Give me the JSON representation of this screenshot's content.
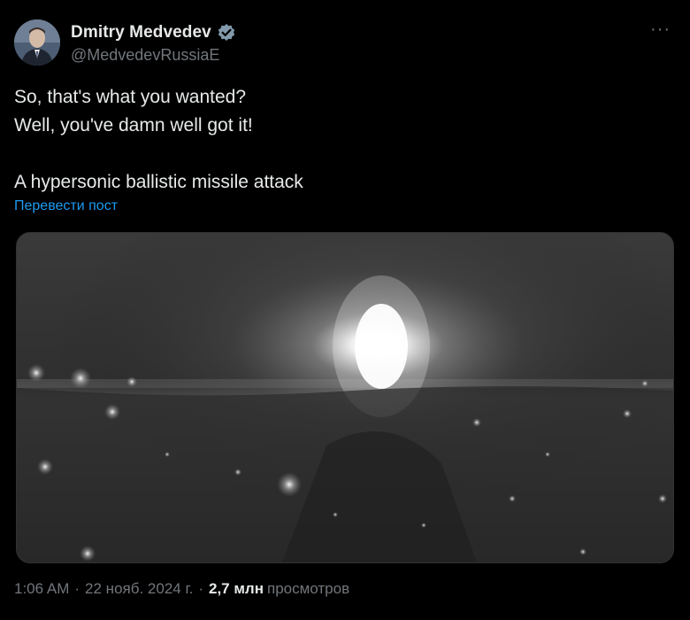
{
  "author": {
    "display_name": "Dmitry Medvedev",
    "handle": "@MedvedevRussiaE",
    "verified": true
  },
  "more_menu": "···",
  "tweet": {
    "lines": [
      "So, that's what you wanted?",
      "Well, you've damn well got it!",
      "A hypersonic ballistic missile attack"
    ],
    "translate_label": "Перевести пост"
  },
  "media": {
    "kind": "video-still",
    "description_icon": "night-explosion-video"
  },
  "meta": {
    "time": "1:06 AM",
    "date": "22 нояб. 2024 г.",
    "separator": "·",
    "views_count": "2,7 млн",
    "views_label": "просмотров"
  },
  "colors": {
    "background": "#000000",
    "text": "#e7e9ea",
    "muted": "#71767b",
    "link": "#1d9bf0",
    "verified_badge": "#829aab"
  }
}
